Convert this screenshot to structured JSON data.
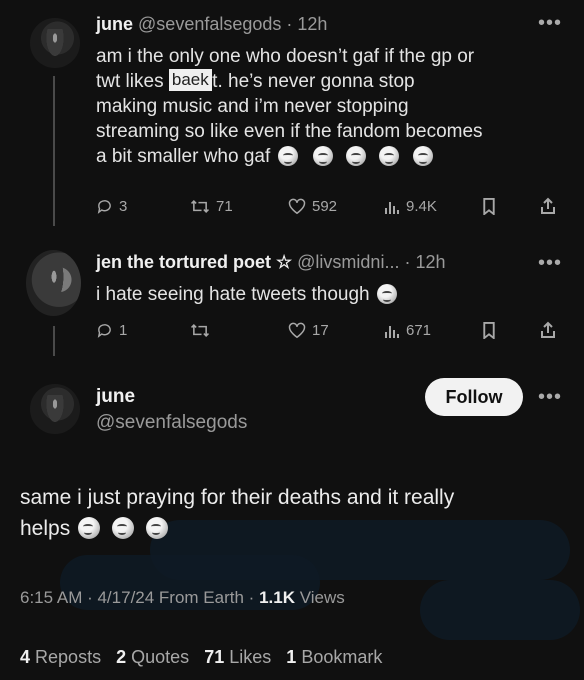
{
  "tweet1": {
    "name": "june",
    "handle": "@sevenfalsegods",
    "time": "· 12h",
    "text_line1": "am i the only one who doesn’t gaf if the gp or",
    "text_line2a": "twt likes",
    "text_overlay": "baek",
    "text_line2b": "or not.   he’s never gonna stop",
    "text_line3": "making music and i’m never stopping",
    "text_line4": "streaming so like even if the fandom becomes",
    "text_line5": "a bit smaller who gaf",
    "replies": "3",
    "reposts": "71",
    "likes": "592",
    "views": "9.4K"
  },
  "tweet2": {
    "name": "jen the tortured poet ☆",
    "handle": "@livsmidni...",
    "time": "· 12h",
    "text": "i hate seeing hate tweets though",
    "replies": "1",
    "reposts": "",
    "likes": "17",
    "views": "671"
  },
  "main": {
    "name": "june",
    "handle": "@sevenfalsegods",
    "follow_label": "Follow",
    "text_line1": "same i just praying for their deaths and it really",
    "text_line2": "helps",
    "meta": "6:15 AM · 4/17/24 From Earth ·",
    "views_count": "1.1K",
    "views_label": "Views",
    "reposts_count": "4",
    "reposts_label": "Reposts",
    "quotes_count": "2",
    "quotes_label": "Quotes",
    "likes_count": "71",
    "likes_label": "Likes",
    "bookmarks_count": "1",
    "bookmarks_label": "Bookmark"
  },
  "more_glyph": "•••"
}
